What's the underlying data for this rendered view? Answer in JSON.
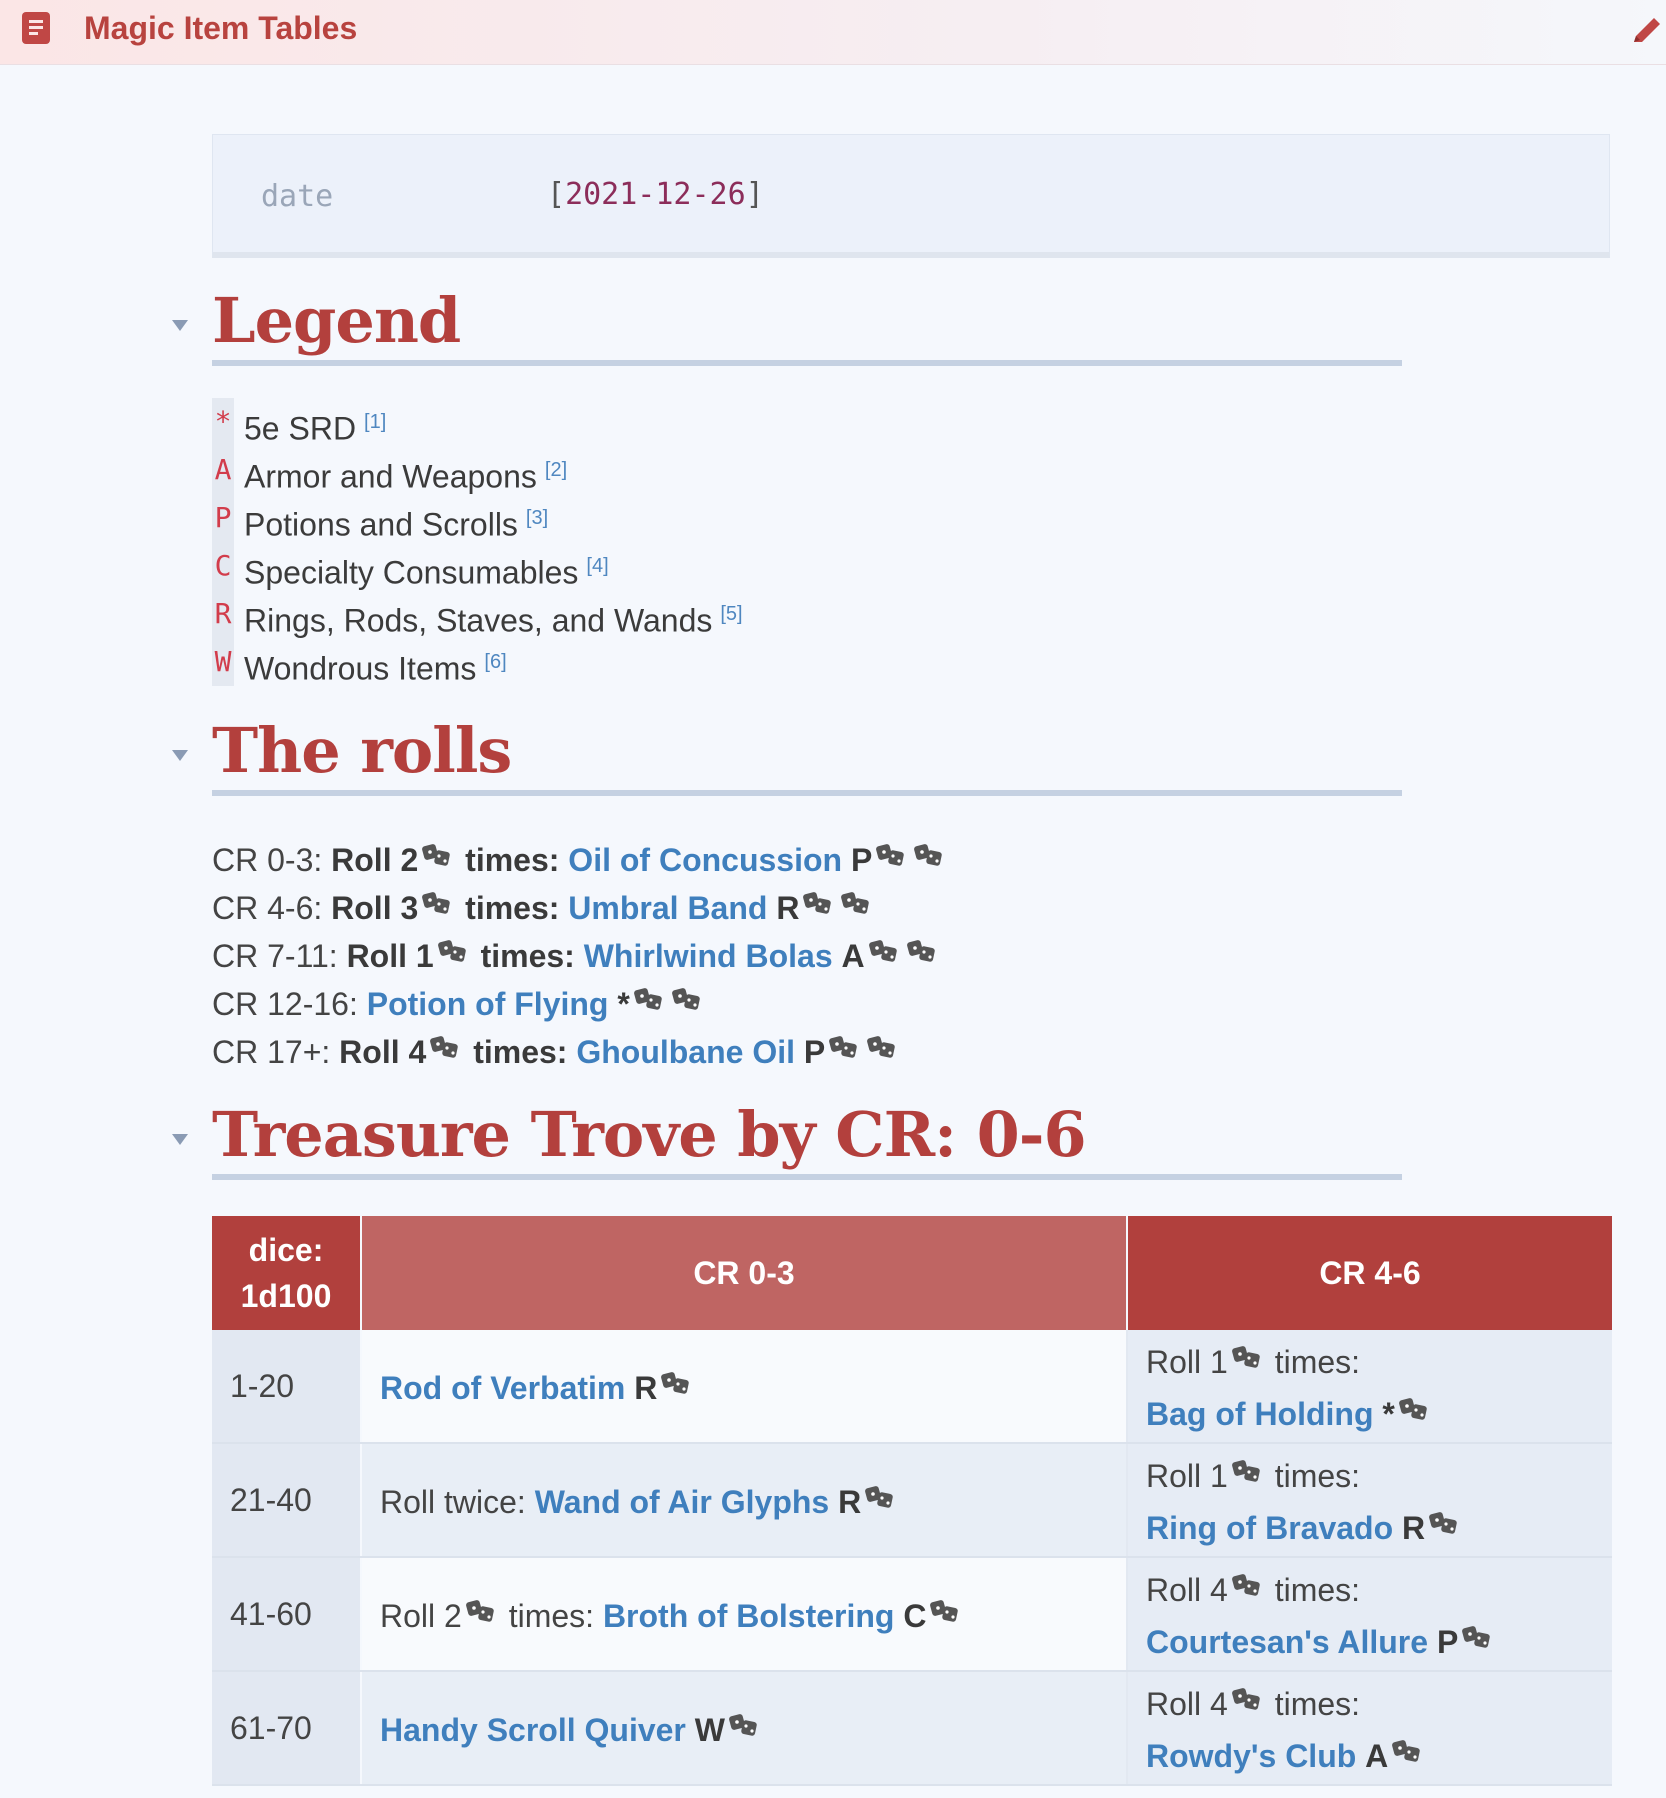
{
  "app": {
    "title": "Magic Item Tables"
  },
  "properties": {
    "key": "date",
    "value": "2021-12-26"
  },
  "legend": {
    "heading": "Legend",
    "items": [
      {
        "code": "*",
        "label": "5e SRD",
        "ref": "[1]"
      },
      {
        "code": "A",
        "label": "Armor and Weapons",
        "ref": "[2]"
      },
      {
        "code": "P",
        "label": "Potions and Scrolls",
        "ref": "[3]"
      },
      {
        "code": "C",
        "label": "Specialty Consumables",
        "ref": "[4]"
      },
      {
        "code": "R",
        "label": "Rings, Rods, Staves, and Wands",
        "ref": "[5]"
      },
      {
        "code": "W",
        "label": "Wondrous Items",
        "ref": "[6]"
      }
    ]
  },
  "rolls": {
    "heading": "The rolls",
    "lines": [
      {
        "cr": "CR 0-3:",
        "roll": "Roll 2",
        "times": "times:",
        "item": "Oil of Concussion",
        "tag": "P"
      },
      {
        "cr": "CR 4-6:",
        "roll": "Roll 3",
        "times": "times:",
        "item": "Umbral Band",
        "tag": "R"
      },
      {
        "cr": "CR 7-11:",
        "roll": "Roll 1",
        "times": "times:",
        "item": "Whirlwind Bolas",
        "tag": "A"
      },
      {
        "cr": "CR 12-16:",
        "item": "Potion of Flying",
        "tag": "*"
      },
      {
        "cr": "CR 17+:",
        "roll": "Roll 4",
        "times": "times:",
        "item": "Ghoulbane Oil",
        "tag": "P"
      }
    ]
  },
  "trove": {
    "heading": "Treasure Trove by CR: 0-6",
    "headers": {
      "dice_line1": "dice:",
      "dice_line2": "1d100",
      "col1": "CR 0-3",
      "col2": "CR 4-6"
    },
    "rows": [
      {
        "range": "1-20",
        "mid_prefix": "",
        "mid_item": "Rod of Verbatim",
        "mid_tag": "R",
        "right_roll": "Roll 1",
        "right_times": "times:",
        "right_item": "Bag of Holding",
        "right_tag": "*"
      },
      {
        "range": "21-40",
        "mid_prefix": "Roll twice:",
        "mid_item": "Wand of Air Glyphs",
        "mid_tag": "R",
        "right_roll": "Roll 1",
        "right_times": "times:",
        "right_item": "Ring of Bravado",
        "right_tag": "R"
      },
      {
        "range": "41-60",
        "mid_prefix": "Roll 2",
        "mid_times": "times:",
        "mid_item": "Broth of Bolstering",
        "mid_tag": "C",
        "right_roll": "Roll 4",
        "right_times": "times:",
        "right_item": "Courtesan's Allure",
        "right_tag": "P"
      },
      {
        "range": "61-70",
        "mid_prefix": "",
        "mid_item": "Handy Scroll Quiver",
        "mid_tag": "W",
        "right_roll": "Roll 4",
        "right_times": "times:",
        "right_item": "Rowdy's Club",
        "right_tag": "A"
      }
    ]
  },
  "colors": {
    "accent": "#b3403d",
    "link": "#3f7fbd",
    "background": "#f5f8fd"
  },
  "icons": {
    "doc": "document-icon",
    "edit": "pencil-icon",
    "dice": "dice-icon",
    "caret": "caret-down-icon"
  }
}
